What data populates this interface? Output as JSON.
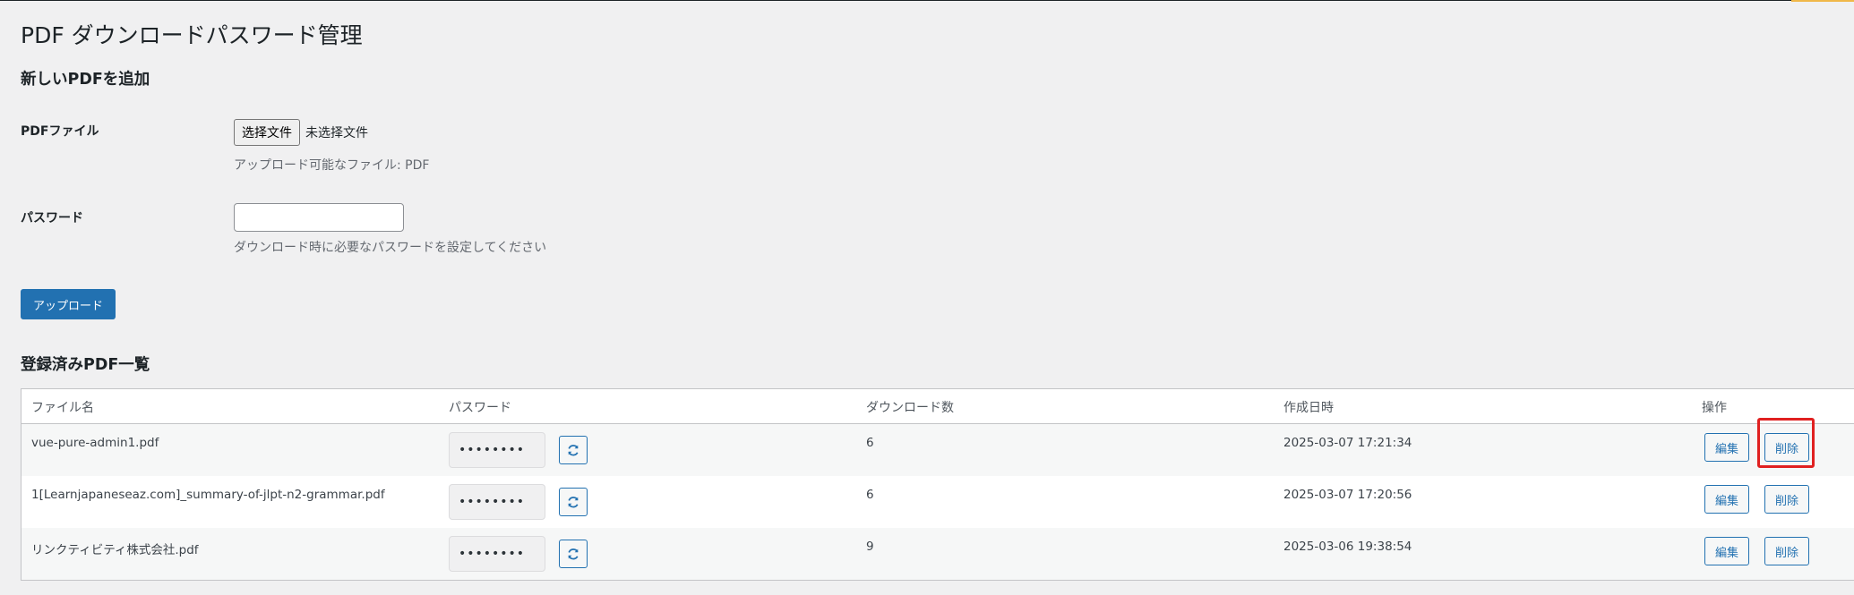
{
  "page": {
    "title": "PDF ダウンロードパスワード管理"
  },
  "add_section": {
    "heading": "新しいPDFを追加",
    "pdf_label": "PDFファイル",
    "file_button": "选择文件",
    "file_status": "未选择文件",
    "file_description": "アップロード可能なファイル: PDF",
    "password_label": "パスワード",
    "password_value": "",
    "password_description": "ダウンロード時に必要なパスワードを設定してください",
    "upload_button": "アップロード"
  },
  "list_section": {
    "heading": "登録済みPDF一覧",
    "columns": [
      "ファイル名",
      "パスワード",
      "ダウンロード数",
      "作成日時",
      "操作"
    ],
    "rows": [
      {
        "file": "vue-pure-admin1.pdf",
        "password": "••••••••",
        "downloads": "6",
        "created": "2025-03-07 17:21:34",
        "edit": "編集",
        "delete": "削除"
      },
      {
        "file": "1[Learnjapaneseaz.com]_summary-of-jlpt-n2-grammar.pdf",
        "password": "••••••••",
        "downloads": "6",
        "created": "2025-03-07 17:20:56",
        "edit": "編集",
        "delete": "削除"
      },
      {
        "file": "リンクティビティ株式会社.pdf",
        "password": "••••••••",
        "downloads": "9",
        "created": "2025-03-06 19:38:54",
        "edit": "編集",
        "delete": "削除"
      }
    ]
  },
  "icons": {
    "refresh": "refresh-icon"
  },
  "colors": {
    "primary": "#2271b1",
    "highlight": "#e02020",
    "background": "#f0f0f1"
  }
}
